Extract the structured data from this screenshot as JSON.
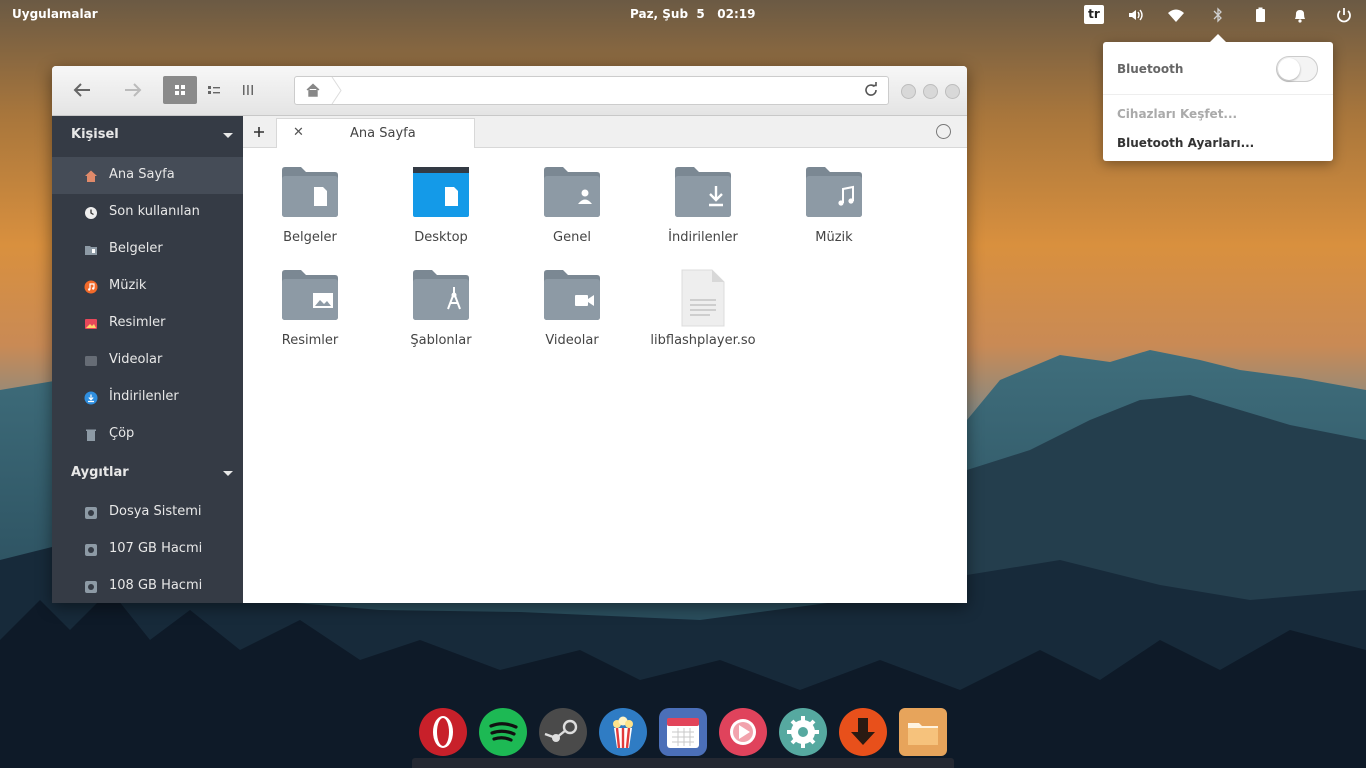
{
  "panel": {
    "applications_label": "Uygulamalar",
    "clock": "Paz, Şub  5   02:19",
    "keyboard_layout": "tr"
  },
  "bluetooth_popover": {
    "title": "Bluetooth",
    "toggle_on": false,
    "discover_label": "Cihazları Keşfet...",
    "settings_label": "Bluetooth Ayarları..."
  },
  "file_manager": {
    "sidebar": {
      "personal_header": "Kişisel",
      "personal_items": [
        {
          "label": "Ana Sayfa",
          "icon": "home-icon"
        },
        {
          "label": "Son kullanılan",
          "icon": "clock-icon"
        },
        {
          "label": "Belgeler",
          "icon": "documents-icon"
        },
        {
          "label": "Müzik",
          "icon": "music-icon"
        },
        {
          "label": "Resimler",
          "icon": "pictures-icon"
        },
        {
          "label": "Videolar",
          "icon": "videos-icon"
        },
        {
          "label": "İndirilenler",
          "icon": "downloads-icon"
        },
        {
          "label": "Çöp",
          "icon": "trash-icon"
        }
      ],
      "devices_header": "Aygıtlar",
      "device_items": [
        {
          "label": "Dosya Sistemi",
          "icon": "drive-icon"
        },
        {
          "label": "107 GB Hacmi",
          "icon": "drive-icon"
        },
        {
          "label": "108 GB Hacmi",
          "icon": "drive-icon"
        }
      ]
    },
    "tab": {
      "label": "Ana Sayfa"
    },
    "items": [
      {
        "label": "Belgeler",
        "icon": "folder-documents-icon"
      },
      {
        "label": "Desktop",
        "icon": "folder-desktop-icon"
      },
      {
        "label": "Genel",
        "icon": "folder-public-icon"
      },
      {
        "label": "İndirilenler",
        "icon": "folder-downloads-icon"
      },
      {
        "label": "Müzik",
        "icon": "folder-music-icon"
      },
      {
        "label": "Resimler",
        "icon": "folder-pictures-icon"
      },
      {
        "label": "Şablonlar",
        "icon": "folder-templates-icon"
      },
      {
        "label": "Videolar",
        "icon": "folder-videos-icon"
      },
      {
        "label": "libflashplayer.so",
        "icon": "text-file-icon"
      }
    ]
  },
  "dock": {
    "apps": [
      "opera-icon",
      "spotify-icon",
      "steam-icon",
      "popcorn-time-icon",
      "calendar-icon",
      "videos-player-icon",
      "settings-icon",
      "downloader-icon",
      "files-icon"
    ]
  },
  "colors": {
    "folder": "#8d9aa5",
    "desktop_folder": "#149ae8",
    "sidebar_bg": "#353b45"
  }
}
